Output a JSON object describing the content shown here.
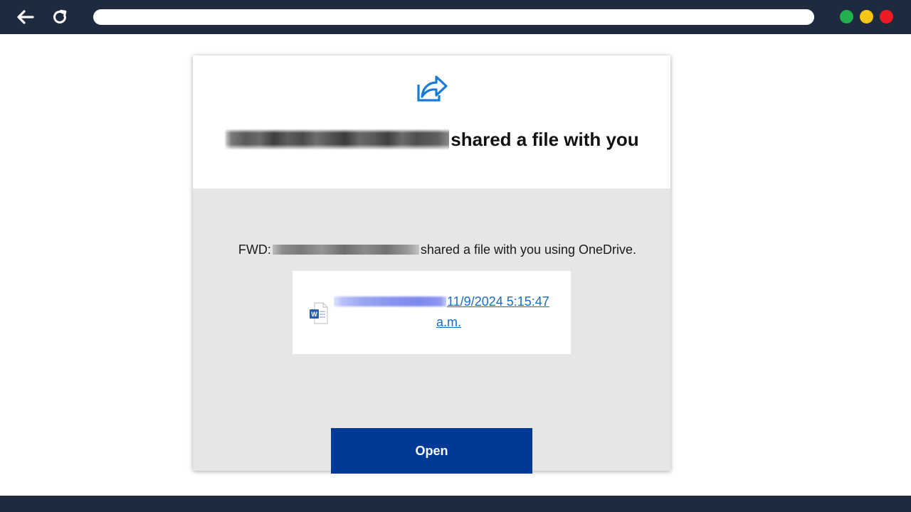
{
  "browser": {
    "back_icon": "arrow-left-icon",
    "reload_icon": "reload-icon",
    "address_value": "",
    "window_dots": [
      {
        "name": "green",
        "color": "#22b14c"
      },
      {
        "name": "yellow",
        "color": "#f5c518"
      },
      {
        "name": "red",
        "color": "#ed1c24"
      }
    ],
    "chrome_color": "#1e2a3e"
  },
  "email": {
    "share_icon": "share-arrow-icon",
    "headline_suffix": "shared a file with you",
    "body_prefix": "FWD:",
    "body_suffix": "shared a file with you using OneDrive.",
    "file_icon": "word-document-icon",
    "file_link_line1": "11/9/2024 5:15:47",
    "file_link_line2": "a.m.",
    "open_button_label": "Open",
    "accent_color": "#003a96",
    "link_color": "#1a6bc4",
    "panel_color": "#e6e6e6"
  }
}
